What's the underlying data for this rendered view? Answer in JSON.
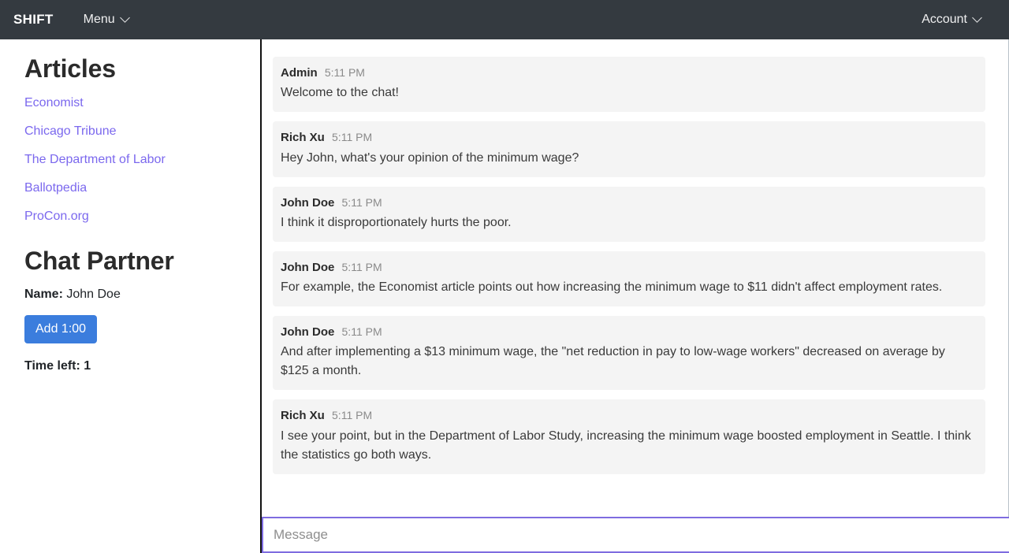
{
  "navbar": {
    "brand": "SHIFT",
    "menu_label": "Menu",
    "menu_caret": "chevron-down",
    "account_label": "Account",
    "account_caret": "chevron-down",
    "background_color": "#343a40"
  },
  "sidebar": {
    "articles_heading": "Articles",
    "articles": [
      {
        "label": "Economist"
      },
      {
        "label": "Chicago Tribune"
      },
      {
        "label": "The Department of Labor"
      },
      {
        "label": "Ballotpedia"
      },
      {
        "label": "ProCon.org"
      }
    ],
    "link_color": "#7b68ee",
    "chat_partner_heading": "Chat Partner",
    "name_label": "Name:",
    "name_value": "John Doe",
    "add_time_button": "Add 1:00",
    "add_time_button_color": "#3b7ddd",
    "time_left": "Time left: 1"
  },
  "chat": {
    "messages": [
      {
        "author": "Admin",
        "time": "5:11 PM",
        "text": "Welcome to the chat!"
      },
      {
        "author": "Rich Xu",
        "time": "5:11 PM",
        "text": "Hey John, what's your opinion of the minimum wage?"
      },
      {
        "author": "John Doe",
        "time": "5:11 PM",
        "text": "I think it disproportionately hurts the poor."
      },
      {
        "author": "John Doe",
        "time": "5:11 PM",
        "text": "For example, the Economist article points out how increasing the minimum wage to $11 didn't affect employment rates."
      },
      {
        "author": "John Doe",
        "time": "5:11 PM",
        "text": "And after implementing a $13 minimum wage, the \"net reduction in pay to low-wage workers\" decreased on average by $125 a month."
      },
      {
        "author": "Rich Xu",
        "time": "5:11 PM",
        "text": "I see your point, but in the Department of Labor Study, increasing the minimum wage boosted employment in Seattle. I think the statistics go both ways."
      }
    ],
    "bubble_color": "#f4f4f4"
  },
  "composer": {
    "value": "",
    "placeholder": "Message",
    "focus_border_color": "#7e6ce0"
  }
}
